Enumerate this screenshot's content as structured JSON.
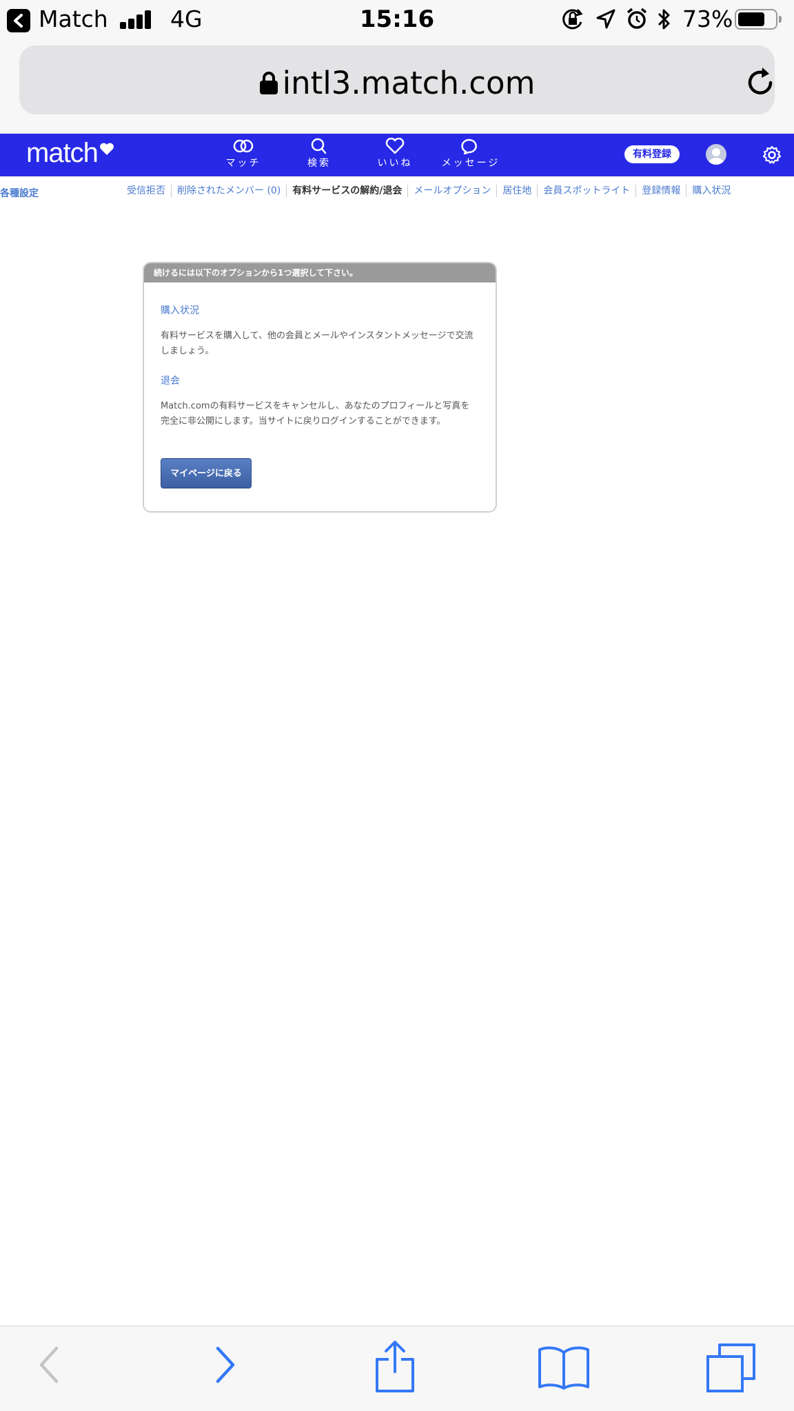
{
  "status_bar": {
    "back_app": "Match",
    "network": "4G",
    "time": "15:16",
    "battery": "73%",
    "battery_level": 0.73
  },
  "browser": {
    "url": "intl3.match.com"
  },
  "header": {
    "logo": "match",
    "nav": [
      {
        "label": "マッチ",
        "icon": "rings-icon"
      },
      {
        "label": "検索",
        "icon": "search-icon"
      },
      {
        "label": "いいね",
        "icon": "heart-icon"
      },
      {
        "label": "メッセージ",
        "icon": "chat-bubble-icon"
      }
    ],
    "paid_button": "有料登録",
    "brand_color": "#2729e6"
  },
  "settings_nav": {
    "title": "各種設定",
    "links": [
      {
        "label": "受信拒否",
        "active": false
      },
      {
        "label": "削除されたメンバー (0)",
        "active": false
      },
      {
        "label": "有料サービスの解約/退会",
        "active": true
      },
      {
        "label": "メールオプション",
        "active": false
      },
      {
        "label": "居住地",
        "active": false
      },
      {
        "label": "会員スポットライト",
        "active": false
      },
      {
        "label": "登録情報",
        "active": false
      },
      {
        "label": "購入状況",
        "active": false
      }
    ]
  },
  "options_box": {
    "header": "続けるには以下のオプションから1つ選択して下さい。",
    "purchase": {
      "link": "購入状況",
      "desc": "有料サービスを購入して、他の会員とメールやインスタントメッセージで交流しましょう。"
    },
    "withdraw": {
      "link": "退会",
      "desc": "Match.comの有料サービスをキャンセルし、あなたのプロフィールと写真を完全に非公開にします。当サイトに戻りログインすることができます。"
    },
    "back_button": "マイページに戻る"
  }
}
